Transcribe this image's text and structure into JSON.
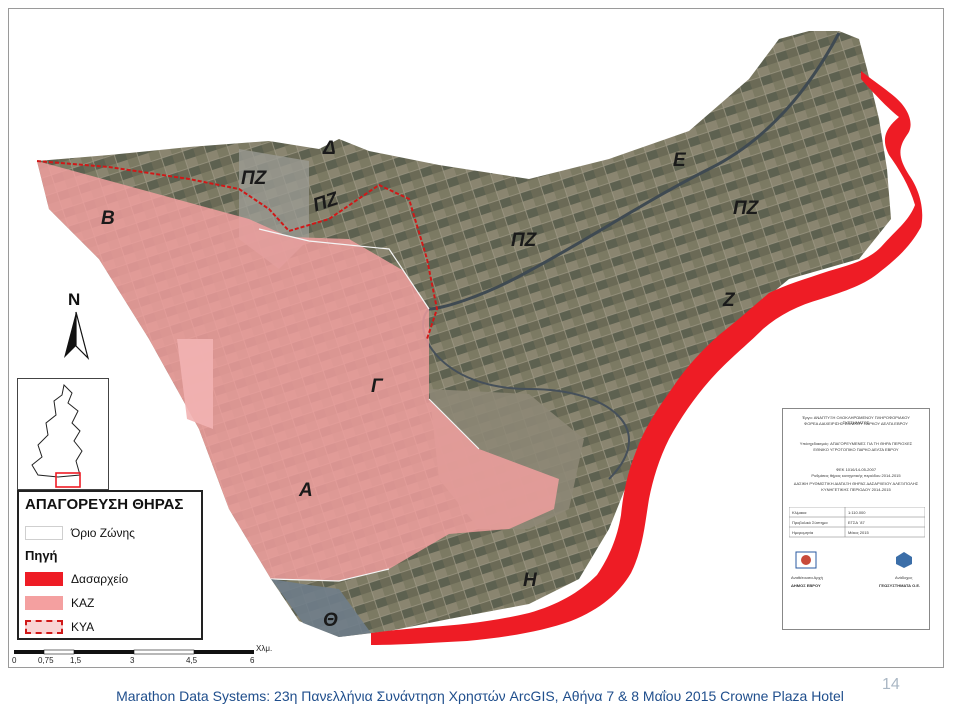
{
  "map": {
    "zone_labels": [
      "Δ",
      "ΠΖ",
      "ΠΖ",
      "Β",
      "ΠΖ",
      "Ε",
      "ΠΖ",
      "Ζ",
      "Γ",
      "Α",
      "Η",
      "Θ"
    ],
    "north_label": "N",
    "colors": {
      "dasarxeio": "#ee1c25",
      "kaz": "#f4a0a0",
      "kya_border": "#d01818",
      "zone_border": "#f5f5f5"
    }
  },
  "legend": {
    "title": "ΑΠΑΓΟΡΕΥΣΗ ΘΗΡΑΣ",
    "zone_border_label": "Όριο Ζώνης",
    "source_title": "Πηγή",
    "items": [
      "Δασαρχείο",
      "ΚΑΖ",
      "ΚΥΑ"
    ]
  },
  "scale": {
    "ticks": [
      "0",
      "0,75",
      "1,5",
      "3",
      "4,5",
      "6"
    ],
    "unit": "Χλμ."
  },
  "info_panel": {
    "line1": "Έργο: ΑΝΑΠΤΥΞΗ ΟΛΟΚΛΗΡΩΜΕΝΟΥ ΠΛΗΡΟΦΟΡΙΑΚΟΥ ΣΥΣΤΗΜΑΤΟΣ",
    "line2": "ΦΟΡΕΑ ΔΙΑΧΕΙΡΙΣΗΣ ΕΘΝΙΚΟΥ ΠΑΡΚΟΥ ΔΕΛΤΑ ΕΒΡΟΥ",
    "line3": "Υπόσχεδιασμός: ΑΠΑΓΟΡΕΥΜΕΝΕΣ ΓΙΑ ΤΗ ΘΗΡΑ ΠΕΡΙΟΧΕΣ",
    "line4": "ΕΘΝΙΚΟ ΥΓΡΟΤΟΠΙΚΟ ΠΑΡΚΟ ΔΕΛΤΑ ΕΒΡΟΥ",
    "line5": "ΦΕΚ 1016/14-05-2007",
    "line6": "Ρυθμίσεις θήρας κυνηγετικής περιόδου 2014-2015",
    "line7": "ΔΑΣΙΚΗ ΡΥΘΜΙΣΤΙΚΗ ΔΙΑΤΑΞΗ ΘΗΡΑΣ ΔΑΣΑΡΧΕΙΟΥ ΑΛΕΞ/ΠΟΛΗΣ",
    "line8": "ΚΥΝΗΓΕΤΙΚΗΣ ΠΕΡΙΟΔΟΥ 2014-2015",
    "row_scale_label": "Κλίμακα",
    "row_scale_value": "1:110.000",
    "row_proj_label": "Προβολικό Σύστημα",
    "row_proj_value": "ΕΓΣΑ ΄87",
    "row_date_label": "Ημερομηνία",
    "row_date_value": "Μάιος 2015",
    "left_org": "ΔΗΜΟΣ ΕΒΡΟΥ",
    "left_caption": "Αναθέτουσα Αρχή",
    "right_org": "ΓΕΩΣΥΣΤΗΜΑΤΑ Ο.Ε.",
    "right_caption": "Ανάδοχος"
  },
  "footer": {
    "text": "Marathon Data Systems: 23η Πανελλήνια Συνάντηση Χρηστών ArcGIS, Αθήνα 7 & 8 Μαΐου 2015 Crowne Plaza Hotel",
    "page_number": "14"
  }
}
